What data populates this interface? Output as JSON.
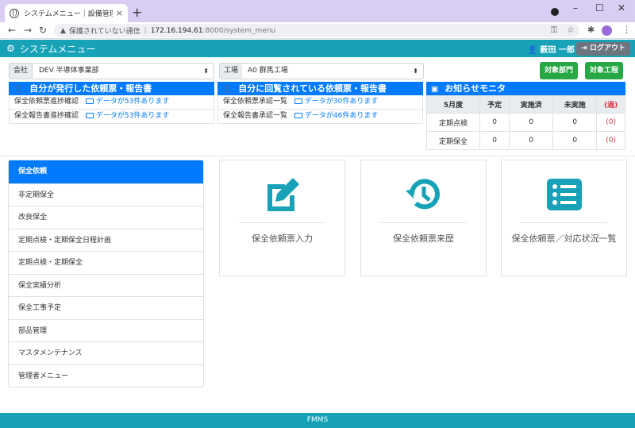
{
  "browser": {
    "tab_title": "システムメニュー｜設備管理システム",
    "tab_close": "×",
    "new_tab": "+",
    "security_warning": "保護されていない通信",
    "url_host": "172.16.194.61",
    "url_path": ":8000/system_menu"
  },
  "header": {
    "title": "システムメニュー",
    "user_name": "薮田 一郎",
    "logout_label": "ログアウト"
  },
  "filters": {
    "company_label": "会社",
    "company_value": "DEV 半導体事業部",
    "plant_label": "工場",
    "plant_value": "A0 群馬工場",
    "dept_button": "対象部門",
    "process_button": "対象工程"
  },
  "issued_panel": {
    "title": "自分が発行した依頼票・報告書",
    "rows": [
      {
        "label": "保全依頼票進捗確認",
        "link": "データが53件あります"
      },
      {
        "label": "保全報告書進捗確認",
        "link": "データが53件あります"
      }
    ]
  },
  "received_panel": {
    "title": "自分に回覧されている依頼票・報告書",
    "rows": [
      {
        "label": "保全依頼票承認一覧",
        "link": "データが30件あります"
      },
      {
        "label": "保全報告書承認一覧",
        "link": "データが46件あります"
      }
    ]
  },
  "monitor": {
    "title": "お知らせモニタ",
    "headers": [
      "5月度",
      "予定",
      "実施済",
      "未実施",
      "(過)"
    ],
    "rows": [
      [
        "定期点検",
        "0",
        "0",
        "0",
        "(0)"
      ],
      [
        "定期保全",
        "0",
        "0",
        "0",
        "(0)"
      ]
    ]
  },
  "sidebar": {
    "items": [
      {
        "label": "保全依頼"
      },
      {
        "label": "非定期保全"
      },
      {
        "label": "改良保全"
      },
      {
        "label": "定期点検・定期保全日程計画"
      },
      {
        "label": "定期点検・定期保全"
      },
      {
        "label": "保全実績分析"
      },
      {
        "label": "保全工事予定"
      },
      {
        "label": "部品管理"
      },
      {
        "label": "マスタメンテナンス"
      },
      {
        "label": "管理者メニュー"
      }
    ]
  },
  "cards": [
    {
      "label": "保全依頼票入力",
      "icon": "edit-icon"
    },
    {
      "label": "保全依頼票来歴",
      "icon": "history-icon"
    },
    {
      "label": "保全依頼票／対応状況一覧",
      "icon": "list-icon"
    }
  ],
  "footer": {
    "text": "FMMS"
  },
  "colors": {
    "teal": "#17a2b8",
    "blue": "#007bff",
    "green": "#28a745",
    "red": "#dc3545"
  }
}
